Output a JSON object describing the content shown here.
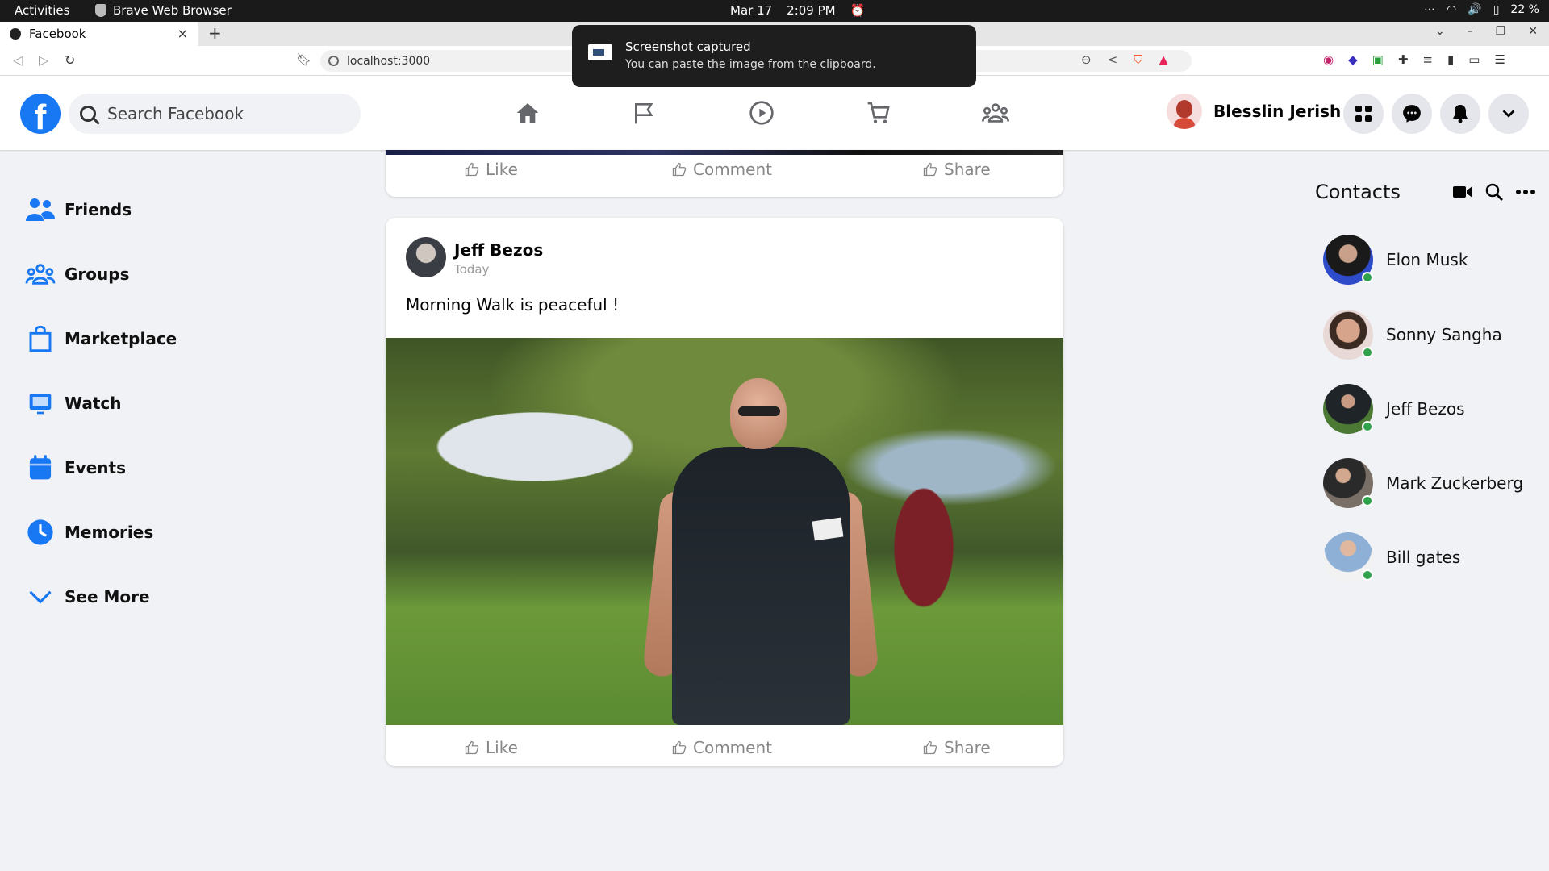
{
  "os": {
    "activities": "Activities",
    "app_name": "Brave Web Browser",
    "date": "Mar 17",
    "time": "2:09 PM",
    "battery": "22 %"
  },
  "browser": {
    "tab_title": "Facebook",
    "tab_close": "×",
    "new_tab": "+",
    "url": "localhost:3000"
  },
  "toast": {
    "title": "Screenshot captured",
    "text": "You can paste the image from the clipboard."
  },
  "header": {
    "logo": "f",
    "search_placeholder": "Search Facebook",
    "user_name": "Blesslin Jerish"
  },
  "sidebar": {
    "items": [
      {
        "label": "Friends",
        "icon": "friends-icon"
      },
      {
        "label": "Groups",
        "icon": "groups-icon"
      },
      {
        "label": "Marketplace",
        "icon": "marketplace-icon"
      },
      {
        "label": "Watch",
        "icon": "watch-icon"
      },
      {
        "label": "Events",
        "icon": "events-icon"
      },
      {
        "label": "Memories",
        "icon": "memories-icon"
      },
      {
        "label": "See More",
        "icon": "chevron-down-icon"
      }
    ]
  },
  "feed": {
    "actions": {
      "like": "Like",
      "comment": "Comment",
      "share": "Share"
    },
    "post": {
      "author": "Jeff Bezos",
      "time": "Today",
      "text": "Morning Walk is peaceful !"
    }
  },
  "contacts": {
    "title": "Contacts",
    "items": [
      {
        "name": "Elon Musk"
      },
      {
        "name": "Sonny Sangha"
      },
      {
        "name": "Jeff Bezos"
      },
      {
        "name": "Mark Zuckerberg"
      },
      {
        "name": "Bill gates"
      }
    ]
  },
  "colors": {
    "brand": "#1877f2",
    "background": "#f0f2f5",
    "online": "#31a24c"
  }
}
